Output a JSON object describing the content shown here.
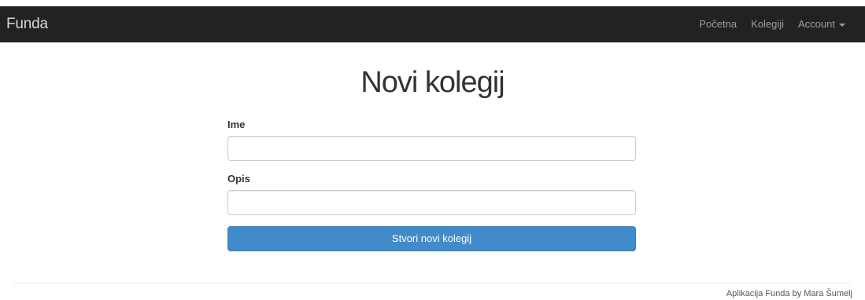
{
  "navbar": {
    "brand": "Funda",
    "links": [
      {
        "label": "Početna"
      },
      {
        "label": "Kolegiji"
      },
      {
        "label": "Account"
      }
    ],
    "background": "#222222"
  },
  "page": {
    "title": "Novi kolegij"
  },
  "form": {
    "name_label": "Ime",
    "name_value": "",
    "description_label": "Opis",
    "description_value": "",
    "submit_label": "Stvori novi kolegij",
    "submit_color": "#428bca"
  },
  "footer": {
    "text": "Aplikacija Funda by Mara Šumelj"
  }
}
